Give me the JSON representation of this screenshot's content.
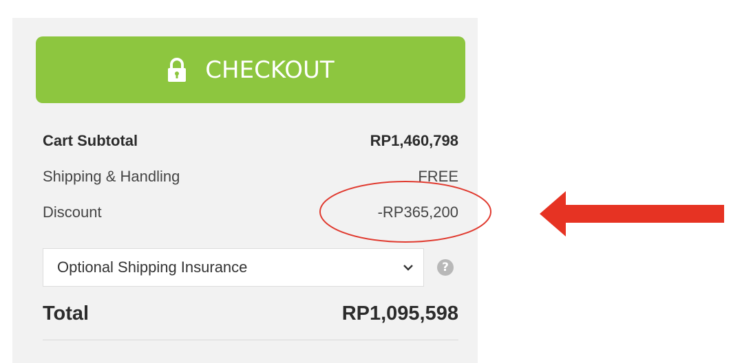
{
  "checkout": {
    "button_label": "CHECKOUT",
    "button_color": "#8dc63f",
    "icon": "lock-icon"
  },
  "summary": {
    "subtotal_label": "Cart Subtotal",
    "subtotal_value": "RP1,460,798",
    "shipping_label": "Shipping & Handling",
    "shipping_value": "FREE",
    "discount_label": "Discount",
    "discount_value": "-RP365,200",
    "insurance_select_value": "Optional Shipping Insurance",
    "help_icon": "question-mark-icon",
    "help_text": "?",
    "total_label": "Total",
    "total_value": "RP1,095,598"
  },
  "annotation": {
    "circle_color": "#e03a2f",
    "arrow_color": "#e63323"
  }
}
